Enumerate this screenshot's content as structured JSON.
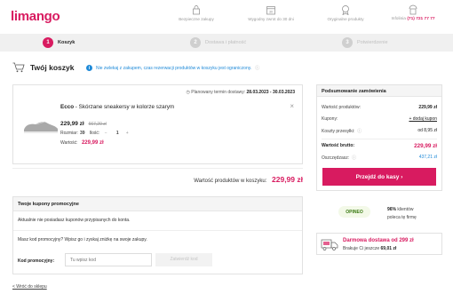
{
  "header": {
    "logo": "limango",
    "features": [
      {
        "label": "Bezpieczne zakupy",
        "icon": "padlock-icon"
      },
      {
        "label": "Wygodny zwrot do 30 dni",
        "icon": "calendar-icon"
      },
      {
        "label": "Oryginalne produkty",
        "icon": "badge-icon"
      }
    ],
    "infoline_label": "Infolinia",
    "infoline_phone": "(71) 721 77 77"
  },
  "steps": [
    {
      "num": "1",
      "label": "Koszyk"
    },
    {
      "num": "2",
      "label": "Dostawa i płatność"
    },
    {
      "num": "3",
      "label": "Potwierdzenie"
    }
  ],
  "cart": {
    "title": "Twój koszyk",
    "notice": "Nie zwlekaj z zakupem, czas rezerwacji produktów w koszyku jest ograniczony."
  },
  "item": {
    "delivery_label": "Planowany termin dostawy:",
    "delivery_dates": "28.03.2023 - 30.03.2023",
    "brand": "Ecco",
    "name": " - Skórzane sneakersy w kolorze szarym",
    "price": "229,99 zł",
    "old_price": "667,20 zł",
    "size_label": "Rozmiar:",
    "size_value": "39",
    "qty_label": "Ilość:",
    "qty_minus": "−",
    "qty_value": "1",
    "qty_plus": "+",
    "value_label": "Wartość:",
    "value": "229,99 zł"
  },
  "subtotal": {
    "label": "Wartość produktów w koszyku:",
    "value": "229,99 zł"
  },
  "coupons": {
    "title": "Twoje kupony promocyjne",
    "none": "Aktualnie nie posiadasz kuponów przypisanych do konta.",
    "question": "Masz kod promocyjny? Wpisz go i zyskaj zniżkę na swoje zakupy.",
    "code_label": "Kod promocyjny:",
    "placeholder": "Tu wpisz kod",
    "apply": "Zatwierdź kod"
  },
  "back_link": "< Wróć do sklepu",
  "summary": {
    "title": "Podsumowanie zamówienia",
    "products_label": "Wartość produktów:",
    "products_value": "229,99 zł",
    "coupons_label": "Kupony:",
    "coupons_link": "+ dodaj kupon",
    "shipping_label": "Koszty przesyłki:",
    "shipping_value": "od 8,95 zł",
    "gross_label": "Wartość brutto:",
    "gross_value": "229,99 zł",
    "savings_label": "Oszczędzasz:",
    "savings_value": "437,21 zł",
    "checkout": "Przejdź do kasy ›"
  },
  "opineo": {
    "brand": "OPINEO",
    "percent": "96%",
    "clients": "klientów",
    "text": "poleca tę firmę"
  },
  "shipping_promo": {
    "title": "Darmowa dostawa od 299 zł",
    "missing_label": "Brakuje Ci jeszcze",
    "missing_value": "69,01 zł"
  }
}
